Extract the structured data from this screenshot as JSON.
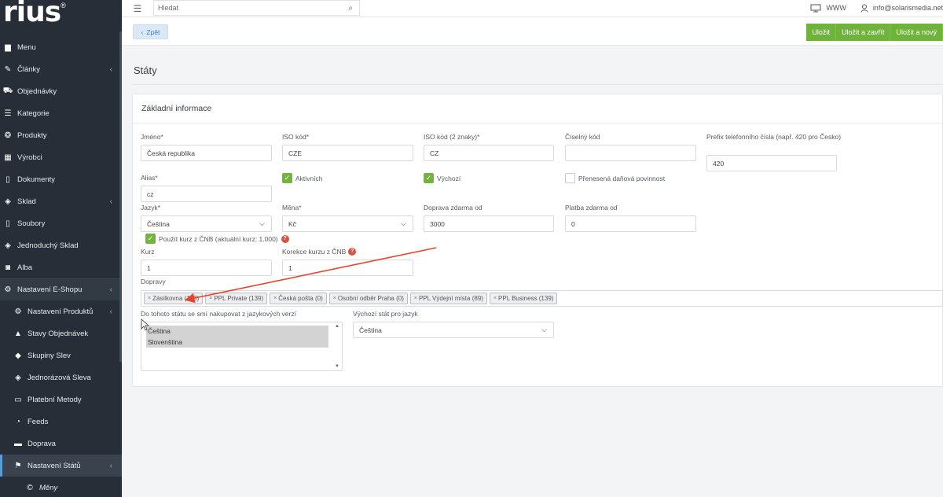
{
  "logo": {
    "text": "rius",
    "reg": "®"
  },
  "sidebar": {
    "items": [
      {
        "label": "Menu",
        "icon": "folder-icon",
        "chevron": false
      },
      {
        "label": "Články",
        "icon": "pen-icon",
        "chevron": true
      },
      {
        "label": "Objednávky",
        "icon": "cart-icon",
        "chevron": false
      },
      {
        "label": "Kategorie",
        "icon": "list-icon",
        "chevron": false
      },
      {
        "label": "Produkty",
        "icon": "cube-icon",
        "chevron": false
      },
      {
        "label": "Výrobci",
        "icon": "building-icon",
        "chevron": false
      },
      {
        "label": "Dokumenty",
        "icon": "document-icon",
        "chevron": false
      },
      {
        "label": "Sklad",
        "icon": "boxes-icon",
        "chevron": true
      },
      {
        "label": "Soubory",
        "icon": "file-icon",
        "chevron": false
      },
      {
        "label": "Jednoduchý Sklad",
        "icon": "boxes-icon",
        "chevron": false
      },
      {
        "label": "Alba",
        "icon": "camera-icon",
        "chevron": false
      },
      {
        "label": "Nastavení E-Shopu",
        "icon": "gears-icon",
        "chevron": true
      },
      {
        "label": "Nastavení Produktů",
        "icon": "gear-icon",
        "chevron": true
      },
      {
        "label": "Stavy Objednávek",
        "icon": "bell-icon",
        "chevron": false
      },
      {
        "label": "Skupiny Slev",
        "icon": "tag-icon",
        "chevron": false
      },
      {
        "label": "Jednorázová Sleva",
        "icon": "tags-icon",
        "chevron": false
      },
      {
        "label": "Platební Metody",
        "icon": "card-icon",
        "chevron": false
      },
      {
        "label": "Feeds",
        "icon": "rss-icon",
        "chevron": false
      },
      {
        "label": "Doprava",
        "icon": "truck-icon",
        "chevron": false
      },
      {
        "label": "Nastavení Států",
        "icon": "flag-icon",
        "chevron": true
      },
      {
        "label": "Měny",
        "icon": "currency-icon",
        "chevron": false
      }
    ]
  },
  "topbar": {
    "search_placeholder": "Hledat",
    "www_label": "WWW",
    "user_email": "info@solarismedia.net"
  },
  "actions": {
    "back_label": "Zpět",
    "save_label": "Uložit",
    "save_close_label": "Uložit a zavřít",
    "save_new_label": "Uložit a nový"
  },
  "page": {
    "title": "Státy"
  },
  "form": {
    "section_title": "Základní informace",
    "name_label": "Jméno*",
    "name_value": "Česká republika",
    "iso_label": "ISO kód*",
    "iso_value": "CZE",
    "iso2_label": "ISO kód (2 znaky)*",
    "iso2_value": "CZ",
    "numeric_label": "Číselný kód",
    "numeric_value": "",
    "prefix_label": "Prefix telefonního čísla (např. 420 pro Česko)",
    "prefix_value": "420",
    "alias_label": "Alias*",
    "alias_value": "cz",
    "active_label": "Aktivních",
    "active_checked": true,
    "default_label": "Výchozí",
    "default_checked": true,
    "reverse_tax_label": "Přenesená daňová povinnost",
    "reverse_tax_checked": false,
    "language_label": "Jazyk*",
    "language_value": "Čeština",
    "currency_label": "Měna*",
    "currency_value": "Kč",
    "free_shipping_label": "Doprava zdarma od",
    "free_shipping_value": "3000",
    "free_payment_label": "Platba zdarma od",
    "free_payment_value": "0",
    "cnb_label": "Použít kurz z ČNB (aktuální kurz: 1.000)",
    "cnb_checked": true,
    "rate_label": "Kurz",
    "rate_value": "1",
    "rate_correction_label": "Korekce kurzu z ČNB",
    "rate_correction_value": "1",
    "shipping_label": "Dopravy",
    "shipping_tags": [
      "Zásilkovna (198)",
      "PPL Private (139)",
      "Česká pošta (0)",
      "Osobní odběr Praha (0)",
      "PPL Výdejní místa (89)",
      "PPL Business (139)"
    ],
    "languages_allowed_label": "Do tohoto státu se smí nakupovat z jazykových verzí",
    "languages_allowed": [
      "Čeština",
      "Slovenština"
    ],
    "default_for_lang_label": "Výchozí stát pro jazyk",
    "default_for_lang_value": "Čeština"
  },
  "help_glyph": "?",
  "colors": {
    "sidebar": "#272e37",
    "save_green": "#6fb33a",
    "checkbox_green": "#74b43e",
    "annotation_arrow": "#e2462d",
    "back_blue": "#3a7dc9"
  }
}
